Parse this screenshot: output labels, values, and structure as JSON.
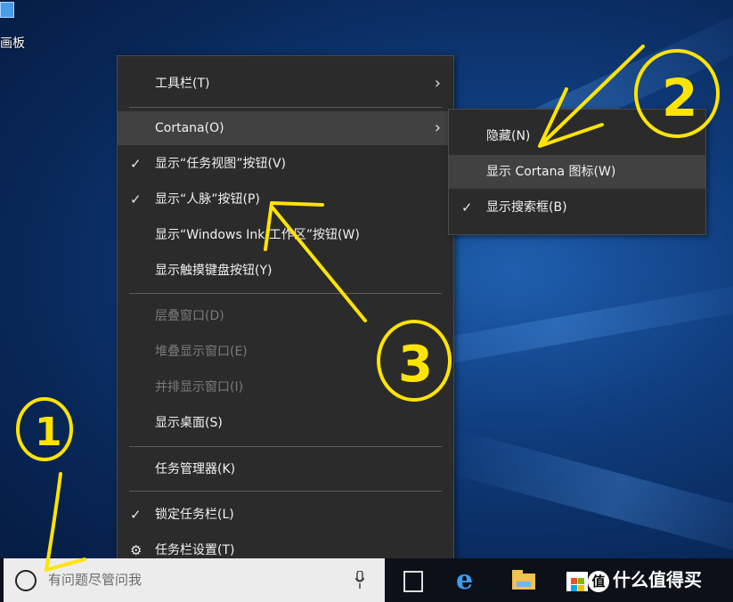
{
  "desktop": {
    "icon_label": "画板"
  },
  "context_menu": {
    "items": [
      {
        "label": "工具栏(T)",
        "checked": false,
        "disabled": false,
        "submenu": true
      },
      {
        "label": "Cortana(O)",
        "checked": false,
        "disabled": false,
        "submenu": true,
        "highlighted": true
      },
      {
        "label": "显示“任务视图”按钮(V)",
        "checked": true,
        "disabled": false
      },
      {
        "label": "显示“人脉”按钮(P)",
        "checked": true,
        "disabled": false
      },
      {
        "label": "显示“Windows Ink 工作区”按钮(W)",
        "checked": false,
        "disabled": false
      },
      {
        "label": "显示触摸键盘按钮(Y)",
        "checked": false,
        "disabled": false
      },
      {
        "label": "层叠窗口(D)",
        "disabled": true
      },
      {
        "label": "堆叠显示窗口(E)",
        "disabled": true
      },
      {
        "label": "并排显示窗口(I)",
        "disabled": true
      },
      {
        "label": "显示桌面(S)",
        "disabled": false
      },
      {
        "label": "任务管理器(K)",
        "disabled": false
      },
      {
        "label": "锁定任务栏(L)",
        "checked": true,
        "disabled": false
      },
      {
        "label": "任务栏设置(T)",
        "icon": "gear-icon",
        "disabled": false
      }
    ]
  },
  "cortana_submenu": {
    "items": [
      {
        "label": "隐藏(N)",
        "checked": false
      },
      {
        "label": "显示 Cortana 图标(W)",
        "checked": false,
        "highlighted": true
      },
      {
        "label": "显示搜索框(B)",
        "checked": true
      }
    ]
  },
  "taskbar": {
    "search_placeholder": "有问题尽管问我",
    "icons": [
      "task-view-icon",
      "edge-icon",
      "file-explorer-icon",
      "store-icon"
    ]
  },
  "watermark": {
    "badge": "值",
    "text": "什么值得买"
  },
  "annotations": {
    "mark1": "1",
    "mark2": "2",
    "mark3": "3",
    "color": "#ffe400"
  },
  "colors": {
    "menu_bg": "#2b2b2b",
    "menu_highlight": "#414141",
    "disabled_text": "#7a7a7a"
  }
}
